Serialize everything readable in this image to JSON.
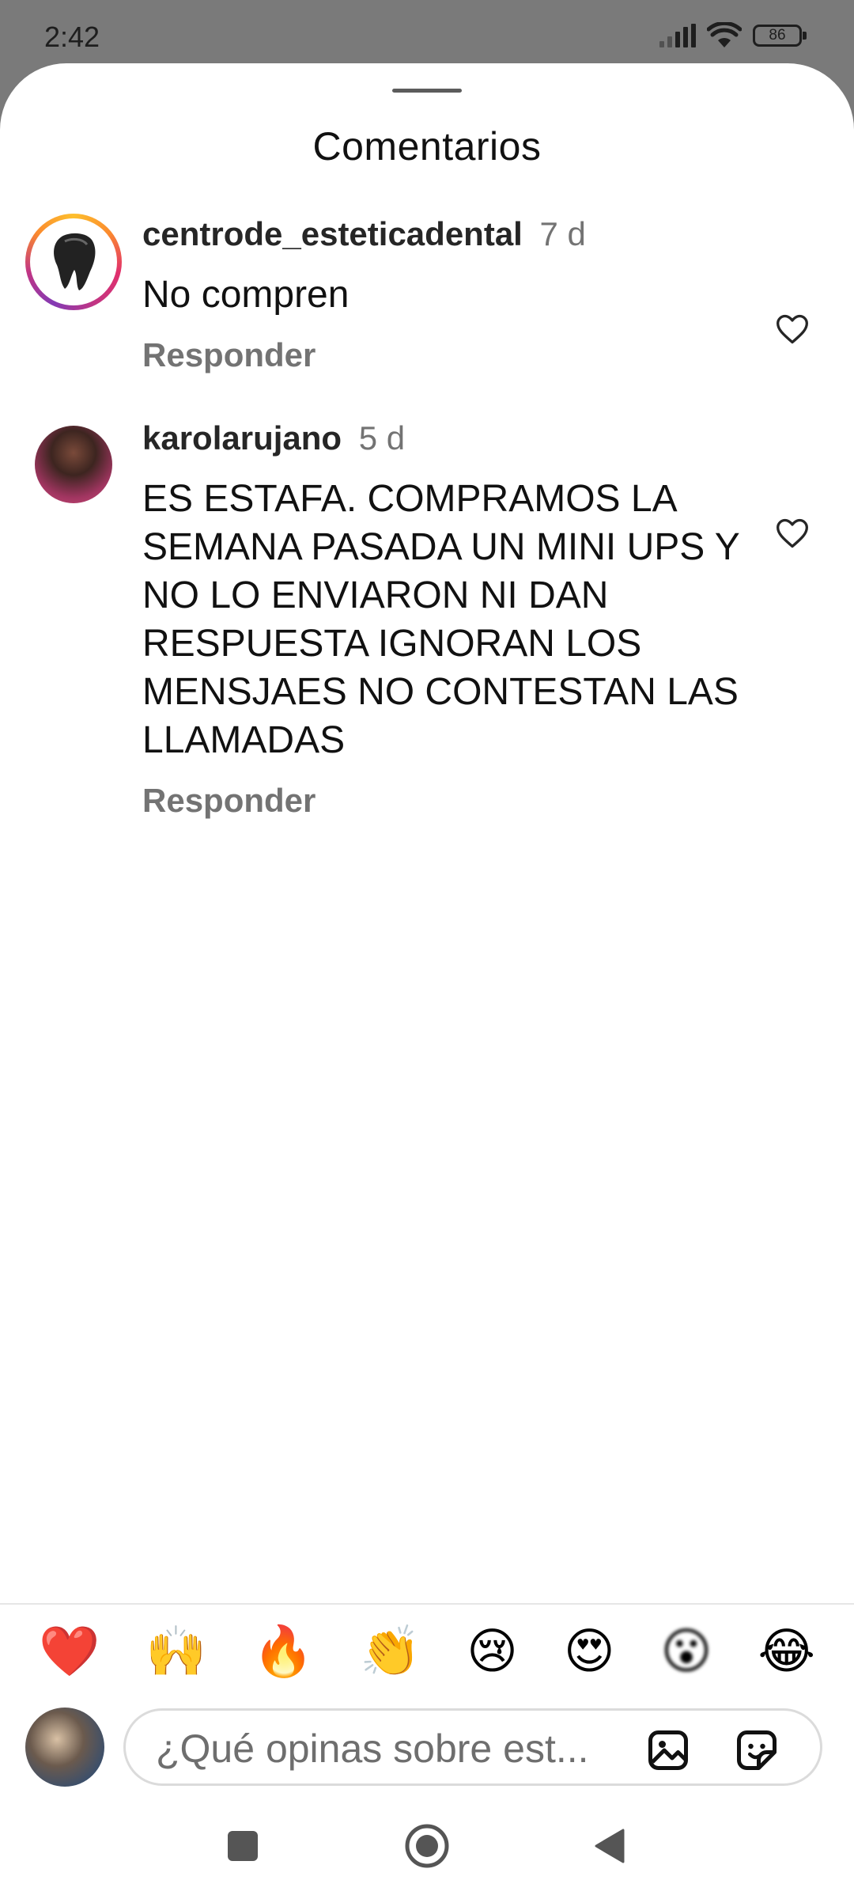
{
  "status_bar": {
    "time": "2:42",
    "battery": "86"
  },
  "sheet": {
    "title": "Comentarios"
  },
  "comments": [
    {
      "username": "centrode_esteticadental",
      "time": "7 d",
      "text": "No compren",
      "reply_label": "Responder",
      "has_story_ring": true,
      "liked": false
    },
    {
      "username": "karolarujano",
      "time": "5 d",
      "text": "ES ESTAFA. COMPRAMOS LA SEMANA PASADA UN MINI UPS Y NO LO ENVIARON NI DAN RESPUESTA IGNORAN LOS MENSJAES NO CONTESTAN LAS LLAMADAS",
      "reply_label": "Responder",
      "has_story_ring": false,
      "liked": false
    }
  ],
  "quick_reactions": [
    "❤️",
    "🙌",
    "🔥",
    "👏",
    "😢",
    "😍",
    "😮",
    "😂"
  ],
  "composer": {
    "placeholder": "¿Qué opinas sobre est..."
  },
  "colors": {
    "secondary_text": "#737373",
    "primary_text": "#111111",
    "status_bar_bg": "#7a7a7a"
  }
}
